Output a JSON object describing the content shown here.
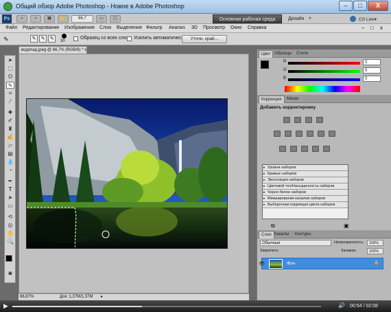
{
  "window": {
    "title": "Общий обзор Adobe Photoshop - Новое в Adobe Photoshop",
    "minimize": "–",
    "maximize": "□",
    "close": "X"
  },
  "appbar": {
    "ps_logo": "Ps",
    "zoom_value": "66,7",
    "workspace_label": "Основная рабочая среда",
    "design_label": "Дизайн",
    "design_chevron": "»",
    "cslive_label": "CS Live",
    "cslive_arrow": "▾",
    "minimize": "–",
    "maximize": "□",
    "close": "x"
  },
  "menubar": {
    "items": [
      "Файл",
      "Редактирование",
      "Изображение",
      "Слои",
      "Выделение",
      "Фильтр",
      "Анализ",
      "3D",
      "Просмотр",
      "Окно",
      "Справка"
    ]
  },
  "options": {
    "brush_size": "30",
    "sample_all_layers": "Образец со всех слоев",
    "auto_enhance": "Усилить автоматически",
    "refine_edge": "Уточн. край..."
  },
  "document": {
    "tab_title": "водопад.jpeg @ 66,7% (RGB/8) *",
    "tab_close": "x",
    "zoom_status": "66,67%",
    "doc_info": "Док: 1,37M/1,37M",
    "status_arrow": "▸"
  },
  "color_panel": {
    "tabs": [
      "Цвет",
      "Образцы",
      "Стили"
    ],
    "channels": [
      {
        "label": "R",
        "value": "0"
      },
      {
        "label": "G",
        "value": "0"
      },
      {
        "label": "B",
        "value": "0"
      }
    ],
    "foreground_color": "#000000",
    "background_color": "#ffffff"
  },
  "adjust_panel": {
    "tabs": [
      "Коррекция",
      "Маски"
    ],
    "heading": "Добавить корректировку",
    "presets": [
      "Уровни наборов",
      "Кривые наборов",
      "Экспозиция наборов",
      "Цветовой тон/Насыщенность наборов",
      "Черно-белое наборов",
      "Микширование каналов наборов",
      "Выборочная коррекция цвета наборов"
    ]
  },
  "layers_panel": {
    "tabs": [
      "Слои",
      "Каналы",
      "Контуры"
    ],
    "blend_mode": "Обычные",
    "opacity_label": "Непрозрачность:",
    "opacity_value": "100%",
    "lock_label": "Закрепить:",
    "fill_label": "Заливка:",
    "fill_value": "100%",
    "layer_name": "Фон",
    "layer_lock": "🔒"
  },
  "player": {
    "time": "00:54 / 02:08",
    "progress": 0.42,
    "play": "▶",
    "volume": "🔊"
  },
  "colors": {
    "title_bar": "#9dc2e6",
    "selected_layer": "#3d8de0",
    "workspace_button": "#4f4f4f"
  }
}
